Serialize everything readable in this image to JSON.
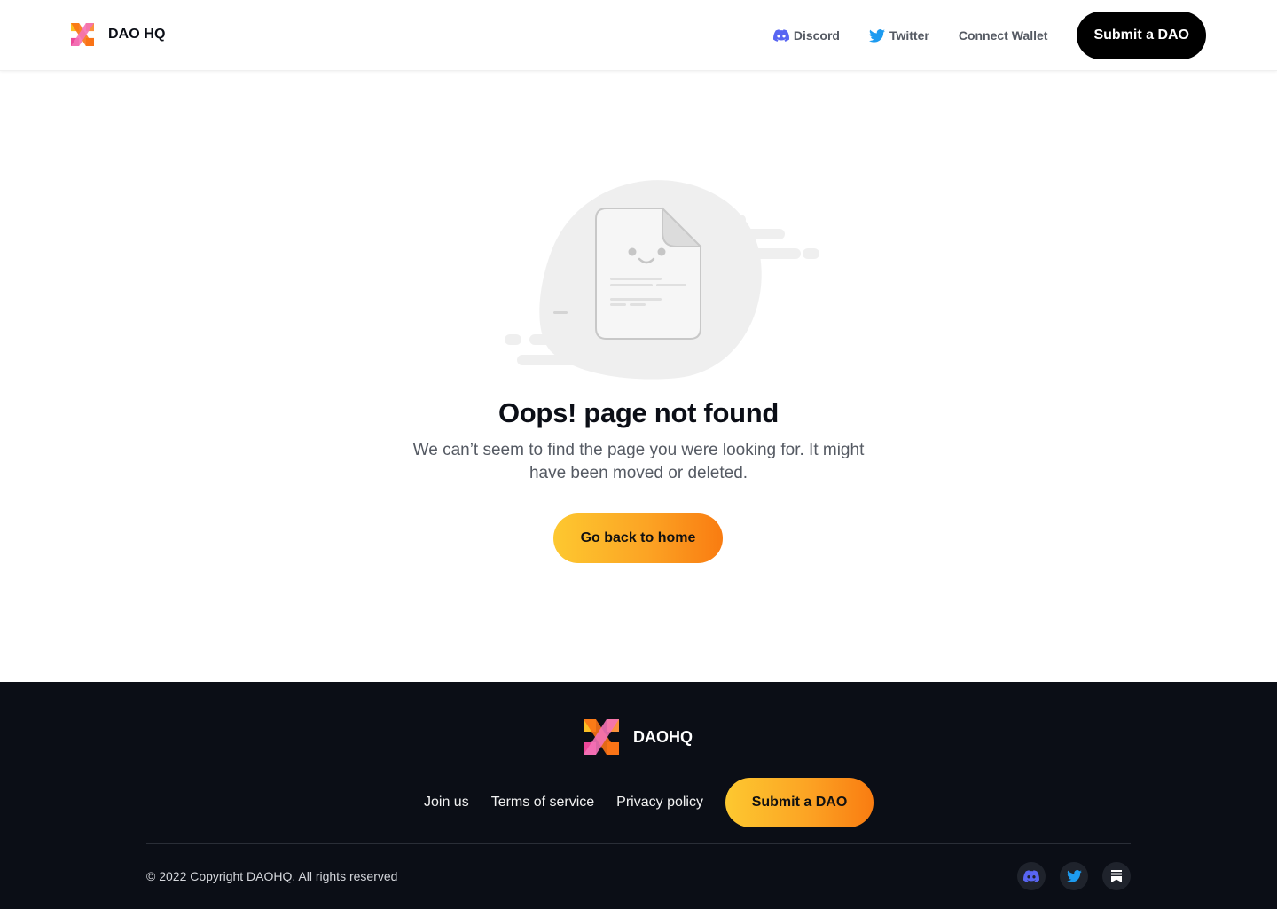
{
  "header": {
    "brand_name": "DAO HQ",
    "nav": [
      {
        "label": "Discord",
        "icon": "discord-icon",
        "color": "#5865f2"
      },
      {
        "label": "Twitter",
        "icon": "twitter-icon",
        "color": "#1d9bf0"
      },
      {
        "label": "Connect Wallet"
      }
    ],
    "submit_label": "Submit a DAO"
  },
  "main": {
    "illustration": "sad-document-icon",
    "title": "Oops! page not found",
    "description": "We can’t seem to find the page you were looking for. It might have been moved or deleted.",
    "home_button": "Go back to home"
  },
  "footer": {
    "brand_name": "DAOHQ",
    "links": [
      "Join us",
      "Terms of service",
      "Privacy policy"
    ],
    "submit_label": "Submit a DAO",
    "copyright": "© 2022 Copyright DAOHQ. All rights reserved",
    "socials": [
      "discord-icon",
      "twitter-icon",
      "substack-icon"
    ]
  },
  "colors": {
    "accent_gradient_start": "#fdc830",
    "accent_gradient_end": "#f97c11",
    "footer_bg": "#0b0e16"
  }
}
